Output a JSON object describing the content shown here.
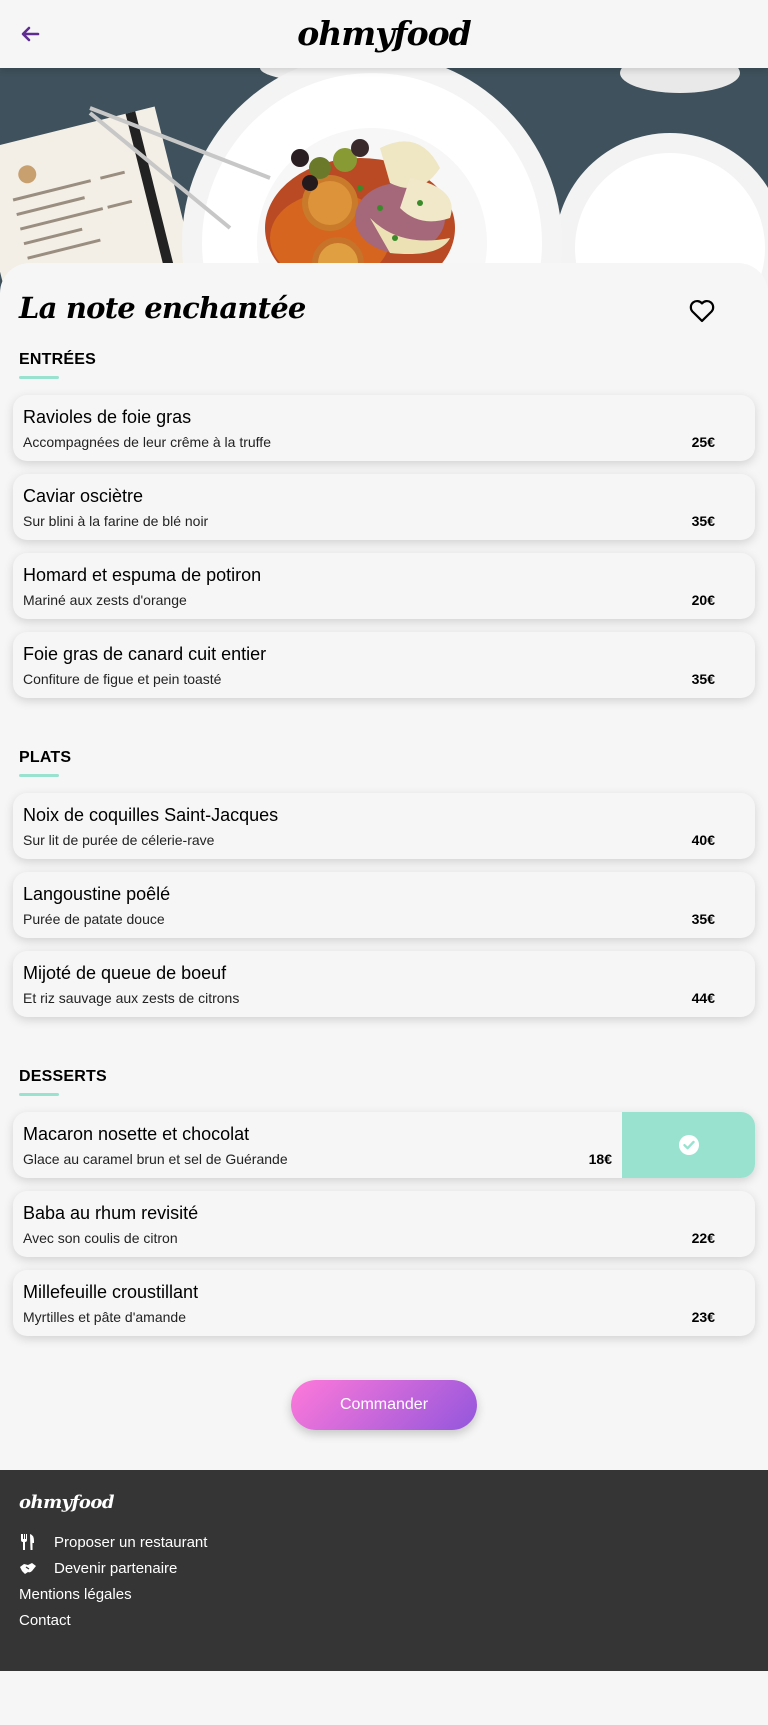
{
  "header": {
    "logo": "ohmyfood"
  },
  "restaurant": {
    "title": "La note enchantée"
  },
  "sections": [
    {
      "title": "ENTRÉES",
      "items": [
        {
          "name": "Ravioles de foie gras",
          "desc": "Accompagnées de leur crême à la truffe",
          "price": "25€"
        },
        {
          "name": "Caviar osciètre",
          "desc": "Sur blini à la farine de blé noir",
          "price": "35€"
        },
        {
          "name": "Homard et espuma de potiron",
          "desc": "Mariné aux zests d'orange",
          "price": "20€"
        },
        {
          "name": "Foie gras de canard cuit entier",
          "desc": "Confiture de figue et pein toasté",
          "price": "35€"
        }
      ]
    },
    {
      "title": "PLATS",
      "items": [
        {
          "name": "Noix de coquilles Saint-Jacques",
          "desc": "Sur lit de purée de célerie-rave",
          "price": "40€"
        },
        {
          "name": "Langoustine poêlé",
          "desc": "Purée de patate douce",
          "price": "35€"
        },
        {
          "name": "Mijoté de queue de boeuf",
          "desc": "Et riz sauvage aux zests de citrons",
          "price": "44€"
        }
      ]
    },
    {
      "title": "DESSERTS",
      "items": [
        {
          "name": "Macaron nosette et chocolat",
          "desc": "Glace au caramel brun et sel de Guérande",
          "price": "18€"
        },
        {
          "name": "Baba au rhum revisité",
          "desc": "Avec son coulis de citron",
          "price": "22€"
        },
        {
          "name": "Millefeuille croustillant",
          "desc": "Myrtilles et pâte d'amande",
          "price": "23€"
        }
      ]
    }
  ],
  "order_button": "Commander",
  "footer": {
    "logo": "ohmyfood",
    "links": [
      {
        "label": "Proposer un restaurant",
        "icon": "utensils-icon"
      },
      {
        "label": "Devenir partenaire",
        "icon": "handshake-icon"
      },
      {
        "label": "Mentions légales",
        "icon": ""
      },
      {
        "label": "Contact",
        "icon": ""
      }
    ]
  },
  "colors": {
    "accent": "#99e2d0",
    "back_arrow": "#5f2d91",
    "footer_bg": "#353535",
    "btn_gradient_start": "#ff79da",
    "btn_gradient_end": "#9356dc"
  }
}
